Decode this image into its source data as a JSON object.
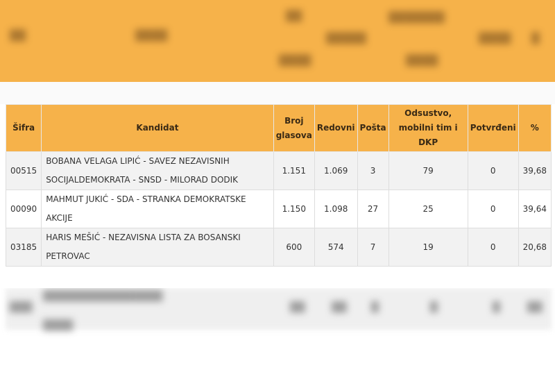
{
  "table": {
    "headers": {
      "sifra": "Šifra",
      "kandidat": "Kandidat",
      "broj_glasova": "Broj glasova",
      "redovni": "Redovni",
      "posta": "Pošta",
      "odsustvo": "Odsustvo, mobilni tim i DKP",
      "potvrdeni": "Potvrđeni",
      "procenat": "%"
    },
    "rows": [
      {
        "sifra": "00515",
        "kandidat": "BOBANA VELAGA LIPIĆ - SAVEZ NEZAVISNIH SOCIJALDEMOKRATA - SNSD - MILORAD DODIK",
        "broj_glasova": "1.151",
        "redovni": "1.069",
        "posta": "3",
        "odsustvo": "79",
        "potvrdeni": "0",
        "procenat": "39,68"
      },
      {
        "sifra": "00090",
        "kandidat": "MAHMUT JUKIĆ - SDA - STRANKA DEMOKRATSKE AKCIJE",
        "broj_glasova": "1.150",
        "redovni": "1.098",
        "posta": "27",
        "odsustvo": "25",
        "potvrdeni": "0",
        "procenat": "39,64"
      },
      {
        "sifra": "03185",
        "kandidat": "HARIS MEŠIĆ - NEZAVISNA LISTA ZA BOSANSKI PETROVAC",
        "broj_glasova": "600",
        "redovni": "574",
        "posta": "7",
        "odsustvo": "19",
        "potvrdeni": "0",
        "procenat": "20,68"
      }
    ]
  },
  "colors": {
    "header_bg": "#f6b24a",
    "row_alt_bg": "#f2f2f2",
    "border": "#dddddd"
  }
}
